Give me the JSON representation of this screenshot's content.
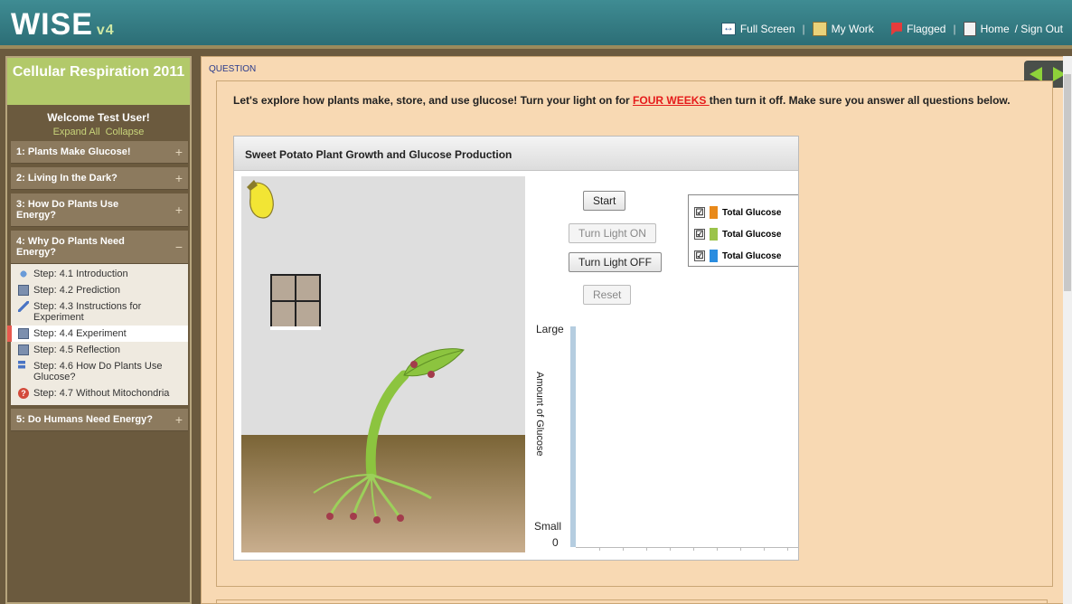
{
  "header": {
    "logo": "WISE",
    "version": "v4",
    "nav": {
      "full_screen": "Full Screen",
      "my_work": "My Work",
      "flagged": "Flagged",
      "home": "Home",
      "sign_out": "/ Sign Out"
    }
  },
  "sidebar": {
    "project_title": "Cellular Respiration 2011",
    "welcome": "Welcome Test User!",
    "expand_all": "Expand All",
    "collapse": "Collapse",
    "activities": [
      {
        "label": "1: Plants Make Glucose!",
        "toggle": "+"
      },
      {
        "label": "2: Living In the Dark?",
        "toggle": "+"
      },
      {
        "label": "3: How Do Plants Use Energy?",
        "toggle": "+"
      },
      {
        "label": "4: Why Do Plants Need Energy?",
        "toggle": "−"
      },
      {
        "label": "5: Do Humans Need Energy?",
        "toggle": "+"
      }
    ],
    "steps": [
      {
        "label": "Step: 4.1 Introduction",
        "icon": "introduction-icon"
      },
      {
        "label": "Step: 4.2 Prediction",
        "icon": "form-icon"
      },
      {
        "label": "Step: 4.3 Instructions for Experiment",
        "icon": "pen-icon"
      },
      {
        "label": "Step: 4.4 Experiment",
        "icon": "form-icon",
        "current": true
      },
      {
        "label": "Step: 4.5 Reflection",
        "icon": "form-icon"
      },
      {
        "label": "Step: 4.6 How Do Plants Use Glucose?",
        "icon": "sequence-icon"
      },
      {
        "label": "Step: 4.7 Without Mitochondria",
        "icon": "challenge-icon"
      }
    ]
  },
  "content": {
    "section_label": "QUESTION",
    "prompt_before": "Let's explore how plants make, store, and use glucose! Turn your light on for ",
    "prompt_highlight": "FOUR WEEKS ",
    "prompt_after": "then turn it off. Make sure you answer all questions below.",
    "simulation": {
      "title": "Sweet Potato Plant Growth and Glucose Production",
      "buttons": {
        "start": "Start",
        "light_on": "Turn Light ON",
        "light_off": "Turn Light OFF",
        "reset": "Reset"
      },
      "legend": [
        {
          "label": "Total Glucose",
          "color": "#e8891a",
          "checked": "☑"
        },
        {
          "label": "Total Glucose",
          "color": "#9bc34a",
          "checked": "☑"
        },
        {
          "label": "Total Glucose",
          "color": "#2a8de0",
          "checked": "☑"
        }
      ],
      "graph": {
        "y_top": "Large",
        "y_bottom": "Small",
        "y_zero": "0",
        "y_title": "Amount of Glucose"
      }
    }
  }
}
